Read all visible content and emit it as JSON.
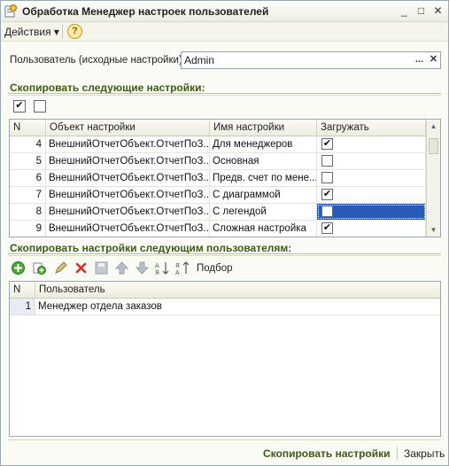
{
  "window": {
    "title": "Обработка  Менеджер настроек пользователей",
    "minimize": "_",
    "maximize": "□",
    "close": "✕"
  },
  "toolbar": {
    "actions_label": "Действия",
    "actions_arrow": "▾",
    "help_label": "?"
  },
  "user": {
    "label": "Пользователь (исходные настройки):",
    "value": "Admin",
    "select_button": "...",
    "clear_button": "✕"
  },
  "copy_settings_section": {
    "title": "Скопировать следующие настройки:",
    "select_all": "✔",
    "deselect_all": ""
  },
  "settings_table": {
    "columns": [
      "N",
      "Объект настройки",
      "Имя настройки",
      "Загружать"
    ],
    "rows": [
      {
        "n": "4",
        "object": "ВнешнийОтчетОбъект.ОтчетПоЗ...",
        "name": "Для менеджеров",
        "load": "✔",
        "selected": false
      },
      {
        "n": "5",
        "object": "ВнешнийОтчетОбъект.ОтчетПоЗ...",
        "name": "Основная",
        "load": "",
        "selected": false
      },
      {
        "n": "6",
        "object": "ВнешнийОтчетОбъект.ОтчетПоЗ...",
        "name": "Предв. счет по мене...",
        "load": "",
        "selected": false
      },
      {
        "n": "7",
        "object": "ВнешнийОтчетОбъект.ОтчетПоЗ...",
        "name": "С диаграммой",
        "load": "✔",
        "selected": false
      },
      {
        "n": "8",
        "object": "ВнешнийОтчетОбъект.ОтчетПоЗ...",
        "name": "С легендой",
        "load": "",
        "selected": true
      },
      {
        "n": "9",
        "object": "ВнешнийОтчетОбъект.ОтчетПоЗ...",
        "name": "Сложная настройка",
        "load": "✔",
        "selected": false
      }
    ]
  },
  "copy_users_section": {
    "title": "Скопировать настройки следующим пользователям:",
    "podbor_label": "Подбор",
    "icons": [
      "add-icon",
      "copy-icon",
      "edit-icon",
      "delete-icon",
      "save-icon",
      "move-up-icon",
      "move-down-icon",
      "sort-asc-icon",
      "sort-desc-icon"
    ]
  },
  "users_table": {
    "columns": [
      "N",
      "Пользователь"
    ],
    "rows": [
      {
        "n": "1",
        "user": "Менеджер отдела заказов"
      }
    ]
  },
  "footer": {
    "copy_button": "Скопировать настройки",
    "close_button": "Закрыть"
  },
  "colors": {
    "accent_green": "#3c5a14",
    "selection_blue": "#2b5bb8",
    "window_bg": "#fbfbf5"
  }
}
